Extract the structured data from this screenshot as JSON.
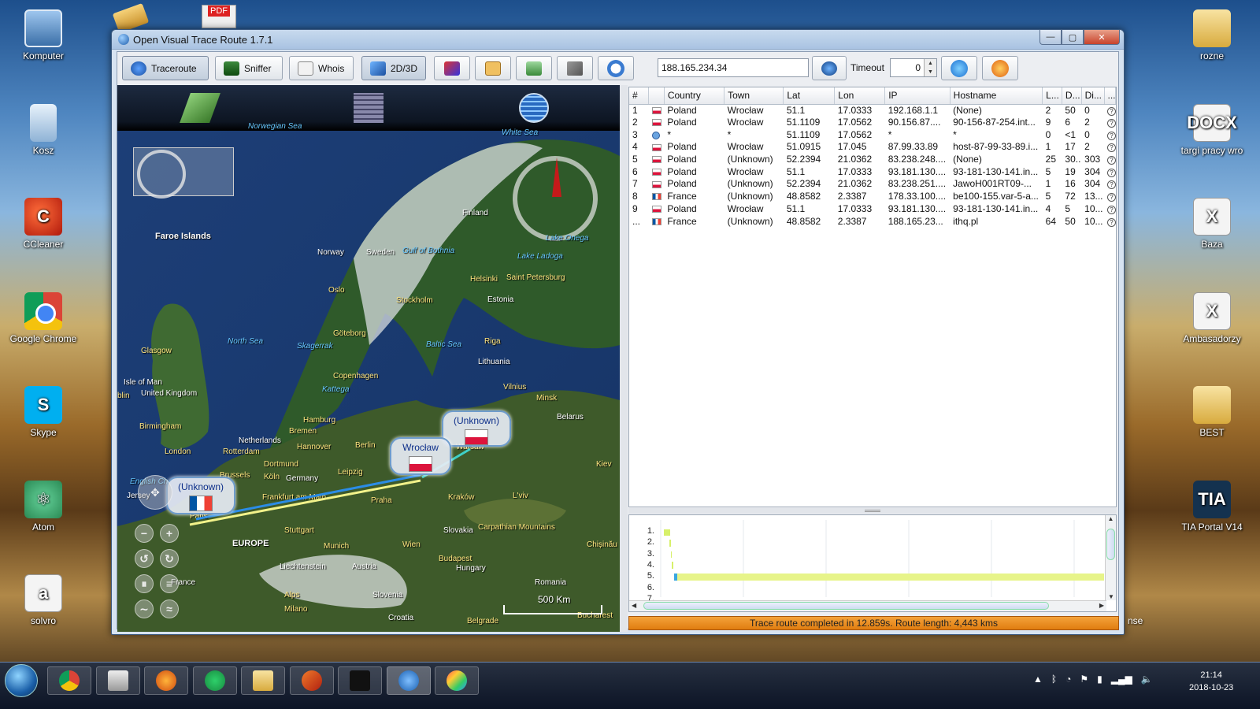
{
  "desktop": {
    "left_icons": [
      {
        "label": "Komputer",
        "icon": "computer-icon"
      },
      {
        "label": "Kosz",
        "icon": "recycle-bin-icon"
      },
      {
        "label": "CCleaner",
        "icon": "ccleaner-icon"
      },
      {
        "label": "Google Chrome",
        "icon": "chrome-icon"
      },
      {
        "label": "Skype",
        "icon": "skype-icon"
      },
      {
        "label": "Atom",
        "icon": "atom-icon"
      },
      {
        "label": "solvro",
        "icon": "spreadsheet-file-icon"
      }
    ],
    "right_icons": [
      {
        "label": "rozne",
        "icon": "folder-icon"
      },
      {
        "label": "targi pracy wro",
        "icon": "docx-file-icon"
      },
      {
        "label": "Baza",
        "icon": "excel-file-icon"
      },
      {
        "label": "Ambasadorzy",
        "icon": "excel-file-icon"
      },
      {
        "label": "BEST",
        "icon": "folder-icon"
      },
      {
        "label": "TIA Portal V14",
        "icon": "tia-portal-icon"
      }
    ],
    "partial_label": "nse",
    "pdf_badge": "PDF"
  },
  "window": {
    "title": "Open Visual Trace Route 1.7.1",
    "controls": {
      "minimize": "—",
      "maximize": "▢",
      "close": "✕"
    }
  },
  "toolbar": {
    "traceroute": "Traceroute",
    "sniffer": "Sniffer",
    "whois": "Whois",
    "mode": "2D/3D",
    "ip_value": "188.165.234.34",
    "timeout_label": "Timeout",
    "timeout_value": "0"
  },
  "map": {
    "labels": [
      {
        "text": "Faroe Islands",
        "kind": "big"
      },
      {
        "text": "Finland",
        "kind": "plain"
      },
      {
        "text": "Norway",
        "kind": "plain"
      },
      {
        "text": "Sweden",
        "kind": "plain"
      },
      {
        "text": "Gulf of Bothnia",
        "kind": "water"
      },
      {
        "text": "Lake Onega",
        "kind": "water"
      },
      {
        "text": "Lake Ladoga",
        "kind": "water"
      },
      {
        "text": "White Sea",
        "kind": "water"
      },
      {
        "text": "Helsinki",
        "kind": "city"
      },
      {
        "text": "Saint Petersburg",
        "kind": "city"
      },
      {
        "text": "Oslo",
        "kind": "city"
      },
      {
        "text": "Stockholm",
        "kind": "city"
      },
      {
        "text": "Estonia",
        "kind": "plain"
      },
      {
        "text": "Göteborg",
        "kind": "city"
      },
      {
        "text": "North Sea",
        "kind": "water"
      },
      {
        "text": "Skagerrak",
        "kind": "water"
      },
      {
        "text": "Baltic Sea",
        "kind": "water"
      },
      {
        "text": "Riga",
        "kind": "city"
      },
      {
        "text": "Glasgow",
        "kind": "city"
      },
      {
        "text": "Lithuania",
        "kind": "plain"
      },
      {
        "text": "Copenhagen",
        "kind": "city"
      },
      {
        "text": "Isle of Man",
        "kind": "plain"
      },
      {
        "text": "United Kingdom",
        "kind": "plain"
      },
      {
        "text": "Kattega",
        "kind": "water"
      },
      {
        "text": "Vilnius",
        "kind": "city"
      },
      {
        "text": "blin",
        "kind": "city"
      },
      {
        "text": "Minsk",
        "kind": "city"
      },
      {
        "text": "Hamburg",
        "kind": "city"
      },
      {
        "text": "Belarus",
        "kind": "plain"
      },
      {
        "text": "Birmingham",
        "kind": "city"
      },
      {
        "text": "Bremen",
        "kind": "city"
      },
      {
        "text": "Netherlands",
        "kind": "plain"
      },
      {
        "text": "Hannover",
        "kind": "city"
      },
      {
        "text": "Berlin",
        "kind": "city"
      },
      {
        "text": "Warsaw",
        "kind": "city"
      },
      {
        "text": "London",
        "kind": "city"
      },
      {
        "text": "Rotterdam",
        "kind": "city"
      },
      {
        "text": "Dortmund",
        "kind": "city"
      },
      {
        "text": "Kiev",
        "kind": "city"
      },
      {
        "text": "Brussels",
        "kind": "city"
      },
      {
        "text": "Köln",
        "kind": "city"
      },
      {
        "text": "Germany",
        "kind": "plain"
      },
      {
        "text": "Leipzig",
        "kind": "city"
      },
      {
        "text": "English Ch",
        "kind": "water"
      },
      {
        "text": "Jersey",
        "kind": "plain"
      },
      {
        "text": "Frankfurt am Main",
        "kind": "city"
      },
      {
        "text": "Kraków",
        "kind": "city"
      },
      {
        "text": "L'viv",
        "kind": "city"
      },
      {
        "text": "Praha",
        "kind": "city"
      },
      {
        "text": "Paris",
        "kind": "city"
      },
      {
        "text": "Stuttgart",
        "kind": "city"
      },
      {
        "text": "Slovakia",
        "kind": "plain"
      },
      {
        "text": "Carpathian Mountains",
        "kind": "city"
      },
      {
        "text": "EUROPE",
        "kind": "big"
      },
      {
        "text": "Munich",
        "kind": "city"
      },
      {
        "text": "Wien",
        "kind": "city"
      },
      {
        "text": "Chișinău",
        "kind": "city"
      },
      {
        "text": "Budapest",
        "kind": "city"
      },
      {
        "text": "Liechtenstein",
        "kind": "plain"
      },
      {
        "text": "Austria",
        "kind": "plain"
      },
      {
        "text": "Hungary",
        "kind": "plain"
      },
      {
        "text": "France",
        "kind": "plain"
      },
      {
        "text": "Romania",
        "kind": "plain"
      },
      {
        "text": "Slovenia",
        "kind": "plain"
      },
      {
        "text": "Alps",
        "kind": "city"
      },
      {
        "text": "Milano",
        "kind": "city"
      },
      {
        "text": "Croatia",
        "kind": "plain"
      },
      {
        "text": "Belgrade",
        "kind": "city"
      },
      {
        "text": "Bucharest",
        "kind": "city"
      },
      {
        "text": "Norwegian Sea",
        "kind": "water"
      }
    ],
    "bubbles": {
      "warsaw": "(Unknown)",
      "wroclaw": "Wrocław",
      "paris": "(Unknown)"
    },
    "scale": "500 Km"
  },
  "table": {
    "headers": [
      "#",
      "",
      "Country",
      "Town",
      "Lat",
      "Lon",
      "IP",
      "Hostname",
      "L...",
      "D...",
      "Di...",
      "..."
    ],
    "rows": [
      {
        "n": "1",
        "flag": "pl",
        "country": "Poland",
        "town": "Wrocław",
        "lat": "51.1",
        "lon": "17.0333",
        "ip": "192.168.1.1",
        "host": "(None)",
        "l": "2",
        "d": "50",
        "di": "0"
      },
      {
        "n": "2",
        "flag": "pl",
        "country": "Poland",
        "town": "Wrocław",
        "lat": "51.1109",
        "lon": "17.0562",
        "ip": "90.156.87....",
        "host": "90-156-87-254.int...",
        "l": "9",
        "d": "6",
        "di": "2"
      },
      {
        "n": "3",
        "flag": "un",
        "country": "*",
        "town": "*",
        "lat": "51.1109",
        "lon": "17.0562",
        "ip": "*",
        "host": "*",
        "l": "0",
        "d": "<1",
        "di": "0"
      },
      {
        "n": "4",
        "flag": "pl",
        "country": "Poland",
        "town": "Wrocław",
        "lat": "51.0915",
        "lon": "17.045",
        "ip": "87.99.33.89",
        "host": "host-87-99-33-89.i...",
        "l": "1",
        "d": "17",
        "di": "2"
      },
      {
        "n": "5",
        "flag": "pl",
        "country": "Poland",
        "town": "(Unknown)",
        "lat": "52.2394",
        "lon": "21.0362",
        "ip": "83.238.248....",
        "host": "(None)",
        "l": "25",
        "d": "30...",
        "di": "303"
      },
      {
        "n": "6",
        "flag": "pl",
        "country": "Poland",
        "town": "Wrocław",
        "lat": "51.1",
        "lon": "17.0333",
        "ip": "93.181.130....",
        "host": "93-181-130-141.in...",
        "l": "5",
        "d": "19",
        "di": "304"
      },
      {
        "n": "7",
        "flag": "pl",
        "country": "Poland",
        "town": "(Unknown)",
        "lat": "52.2394",
        "lon": "21.0362",
        "ip": "83.238.251....",
        "host": "JawoH001RT09-...",
        "l": "1",
        "d": "16",
        "di": "304"
      },
      {
        "n": "8",
        "flag": "fr",
        "country": "France",
        "town": "(Unknown)",
        "lat": "48.8582",
        "lon": "2.3387",
        "ip": "178.33.100....",
        "host": "be100-155.var-5-a...",
        "l": "5",
        "d": "72",
        "di": "13..."
      },
      {
        "n": "9",
        "flag": "pl",
        "country": "Poland",
        "town": "Wrocław",
        "lat": "51.1",
        "lon": "17.0333",
        "ip": "93.181.130....",
        "host": "93-181-130-141.in...",
        "l": "4",
        "d": "5",
        "di": "10..."
      },
      {
        "n": "...",
        "flag": "fr",
        "country": "France",
        "town": "(Unknown)",
        "lat": "48.8582",
        "lon": "2.3387",
        "ip": "188.165.23...",
        "host": "ithq.pl",
        "l": "64",
        "d": "50",
        "di": "10..."
      }
    ]
  },
  "graph": {
    "labels": [
      "1.",
      "2.",
      "3.",
      "4.",
      "5.",
      "6.",
      "7."
    ]
  },
  "status": "Trace route completed in 12.859s. Route length: 4,443 kms",
  "taskbar": {
    "apps": [
      "chrome-icon",
      "scanner-icon",
      "firefox-icon",
      "spotify-icon",
      "explorer-icon",
      "matlab-icon",
      "cmd-icon",
      "ovtr-icon",
      "paint-icon"
    ],
    "time": "21:14",
    "date": "2018-10-23"
  },
  "colors": {
    "status_bar": "#f08a1c",
    "route_blue": "#2b8ce6",
    "route_yellow": "#f2f28a",
    "route_cyan": "#3fd0c8"
  }
}
